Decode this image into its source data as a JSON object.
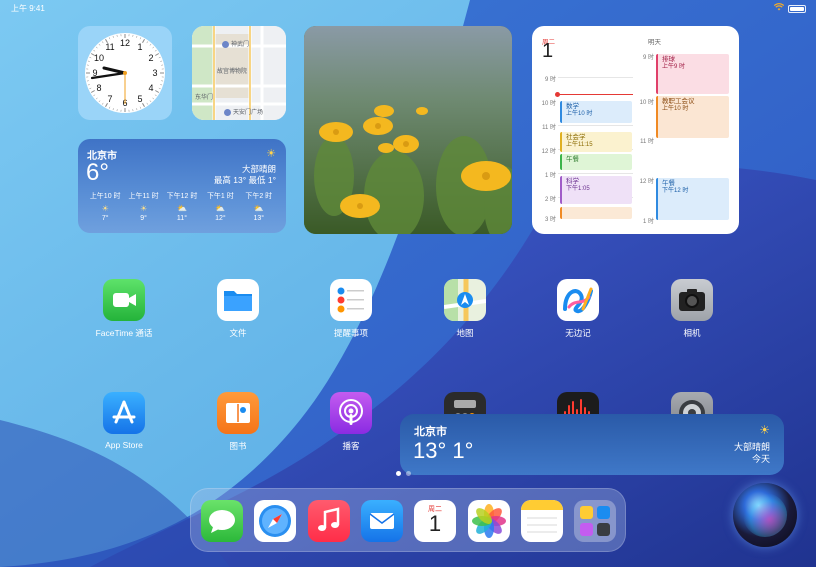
{
  "status_bar": {
    "time": "上午 9:41",
    "wifi_icon": "wifi-icon",
    "battery_level": 1.0
  },
  "map_widget": {
    "labels": [
      "神武门",
      "故宫博物院",
      "东华门",
      "天安门广场"
    ]
  },
  "weather_widget": {
    "city": "北京市",
    "temperature": "6°",
    "condition": "大部晴朗",
    "high_low": "最高 13° 最低 1°",
    "hourly": [
      {
        "time": "上午10 时",
        "icon": "sun-icon",
        "temp": "7°"
      },
      {
        "time": "上午11 时",
        "icon": "sun-icon",
        "temp": "9°"
      },
      {
        "time": "下午12 时",
        "icon": "partly-cloudy-icon",
        "temp": "11°"
      },
      {
        "time": "下午1 时",
        "icon": "partly-cloudy-icon",
        "temp": "12°"
      },
      {
        "time": "下午2 时",
        "icon": "partly-cloudy-icon",
        "temp": "13°"
      }
    ]
  },
  "calendar_widget": {
    "today_label": "周二",
    "today_date": "1",
    "tomorrow_label": "明天",
    "today_times": [
      "9 时",
      "10 时",
      "11 时",
      "12 时",
      "1 时",
      "2 时",
      "3 时"
    ],
    "tomorrow_times": [
      "9 时",
      "10 时",
      "11 时",
      "12 时",
      "1 时"
    ],
    "today_events": [
      {
        "title": "数学",
        "time": "上午10 时"
      },
      {
        "title": "社会学",
        "time": "上午11:15"
      },
      {
        "title": "午餐",
        "time": ""
      },
      {
        "title": "科学",
        "time": "下午1:05"
      }
    ],
    "tomorrow_events": [
      {
        "title": "排球",
        "time": "上午9 时"
      },
      {
        "title": "教职工会议",
        "time": "上午10 时"
      },
      {
        "title": "午餐",
        "time": "下午12 时"
      }
    ]
  },
  "apps": [
    {
      "label": "FaceTime 通话",
      "icon": "facetime-icon"
    },
    {
      "label": "文件",
      "icon": "files-icon"
    },
    {
      "label": "提醒事项",
      "icon": "reminders-icon"
    },
    {
      "label": "地图",
      "icon": "maps-icon"
    },
    {
      "label": "无边记",
      "icon": "freeform-icon"
    },
    {
      "label": "相机",
      "icon": "camera-icon"
    },
    {
      "label": "App Store",
      "icon": "app-store-icon"
    },
    {
      "label": "图书",
      "icon": "books-icon"
    },
    {
      "label": "播客",
      "icon": "podcasts-icon"
    },
    {
      "label": "",
      "icon": "calculator-icon"
    },
    {
      "label": "",
      "icon": "voice-memos-icon"
    },
    {
      "label": "",
      "icon": "settings-icon"
    }
  ],
  "weather_banner": {
    "city": "北京市",
    "temps": "13° 1°",
    "condition": "大部晴朗",
    "day": "今天"
  },
  "page_dots": {
    "count": 2,
    "active_index": 0
  },
  "dock": {
    "apps": [
      "messages-icon",
      "safari-icon",
      "music-icon",
      "mail-icon",
      "calendar-icon",
      "photos-icon",
      "notes-icon",
      "app-library-icon"
    ],
    "calendar_day": "周二",
    "calendar_date": "1"
  },
  "siri": {
    "icon": "siri-icon"
  }
}
